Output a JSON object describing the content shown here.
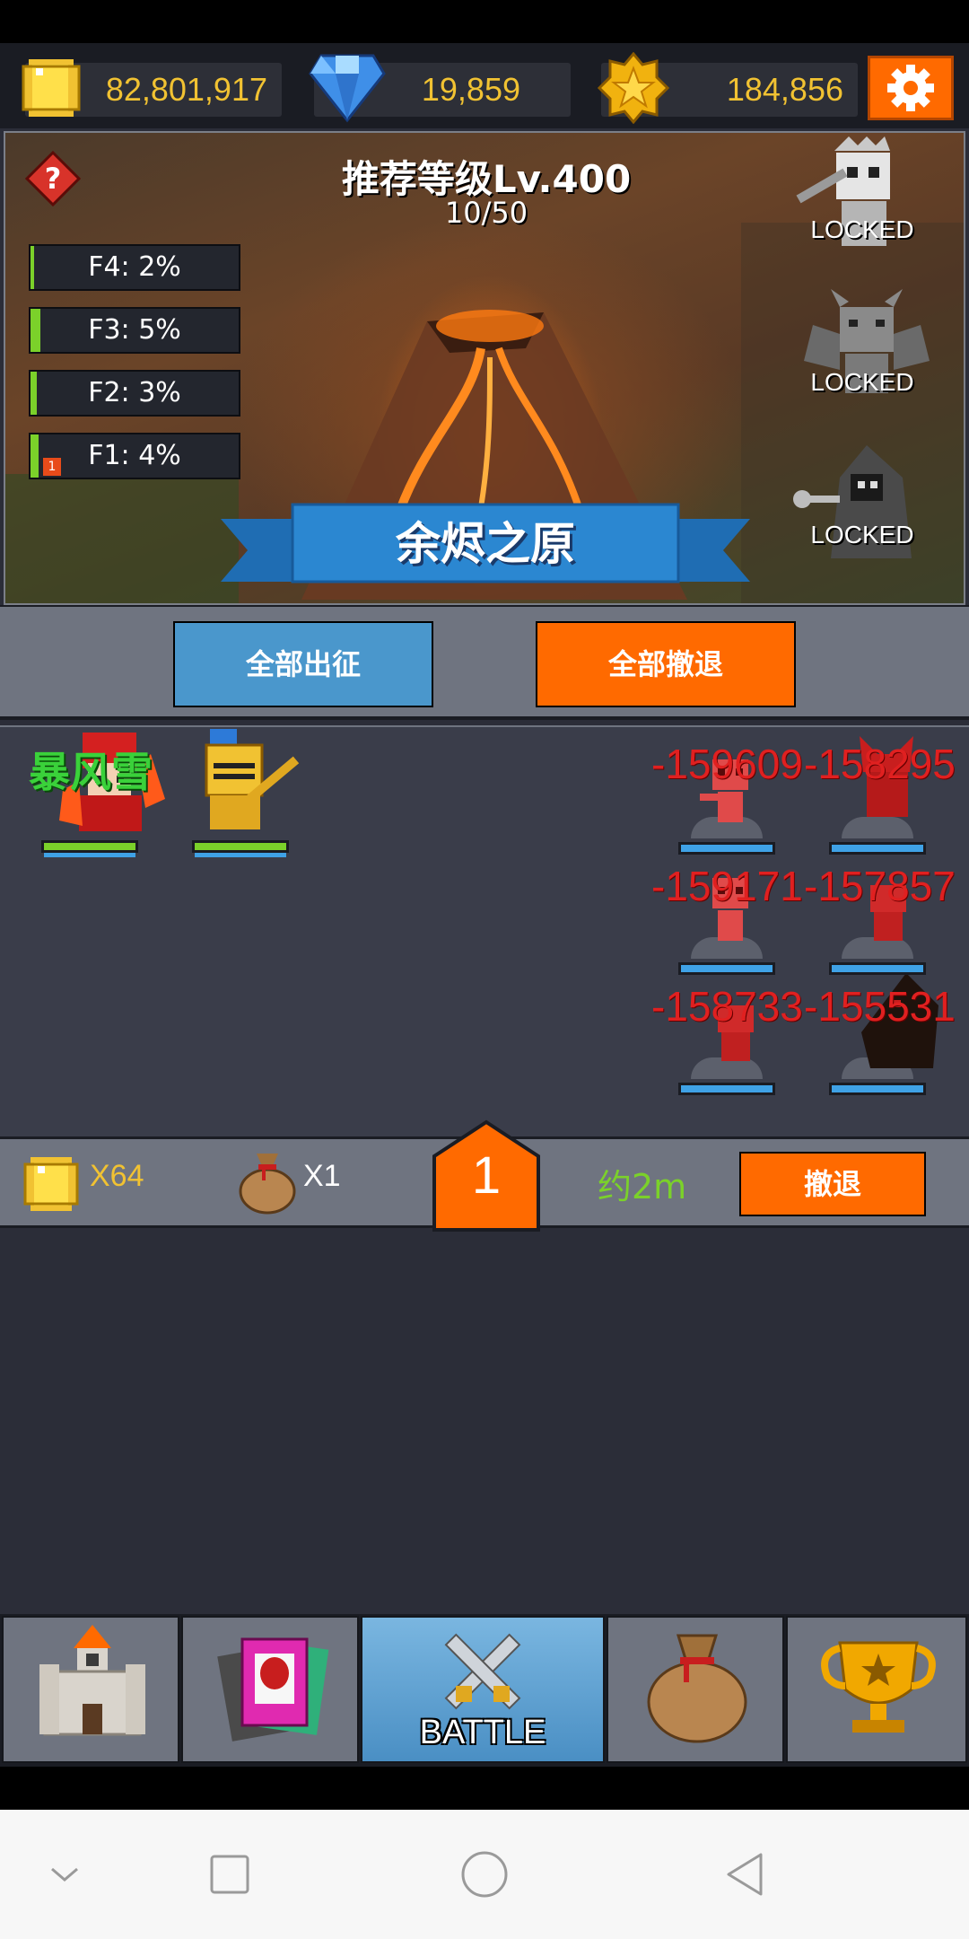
{
  "currency": {
    "gold": "82,801,917",
    "diamonds": "19,859",
    "stars": "184,856"
  },
  "stage": {
    "recommended_level": "推荐等级Lv.400",
    "progress": "10/50",
    "name": "余烬之原",
    "floors": [
      {
        "label": "F4: 2%",
        "percent": 2
      },
      {
        "label": "F3: 5%",
        "percent": 5
      },
      {
        "label": "F2: 3%",
        "percent": 3
      },
      {
        "label": "F1: 4%",
        "percent": 4,
        "badge": "1"
      }
    ],
    "bosses": [
      {
        "status": "LOCKED"
      },
      {
        "status": "LOCKED"
      },
      {
        "status": "LOCKED"
      }
    ]
  },
  "actions": {
    "deploy_all": "全部出征",
    "retreat_all": "全部撤退"
  },
  "battle": {
    "skill_text": "暴风雪",
    "damage_numbers": [
      "-159609",
      "-158295",
      "-159171",
      "-157857",
      "-158733",
      "-155531"
    ]
  },
  "info": {
    "coin_reward": "X64",
    "bag_reward": "X1",
    "wave": "1",
    "time_estimate": "约2m",
    "retreat": "撤退"
  },
  "nav": {
    "battle_label": "BATTLE"
  },
  "colors": {
    "accent_orange": "#ff6a00",
    "button_blue": "#4a97cc",
    "gold_text": "#f1c232",
    "hp_green": "#7bd12a",
    "damage_red": "#e02020"
  }
}
